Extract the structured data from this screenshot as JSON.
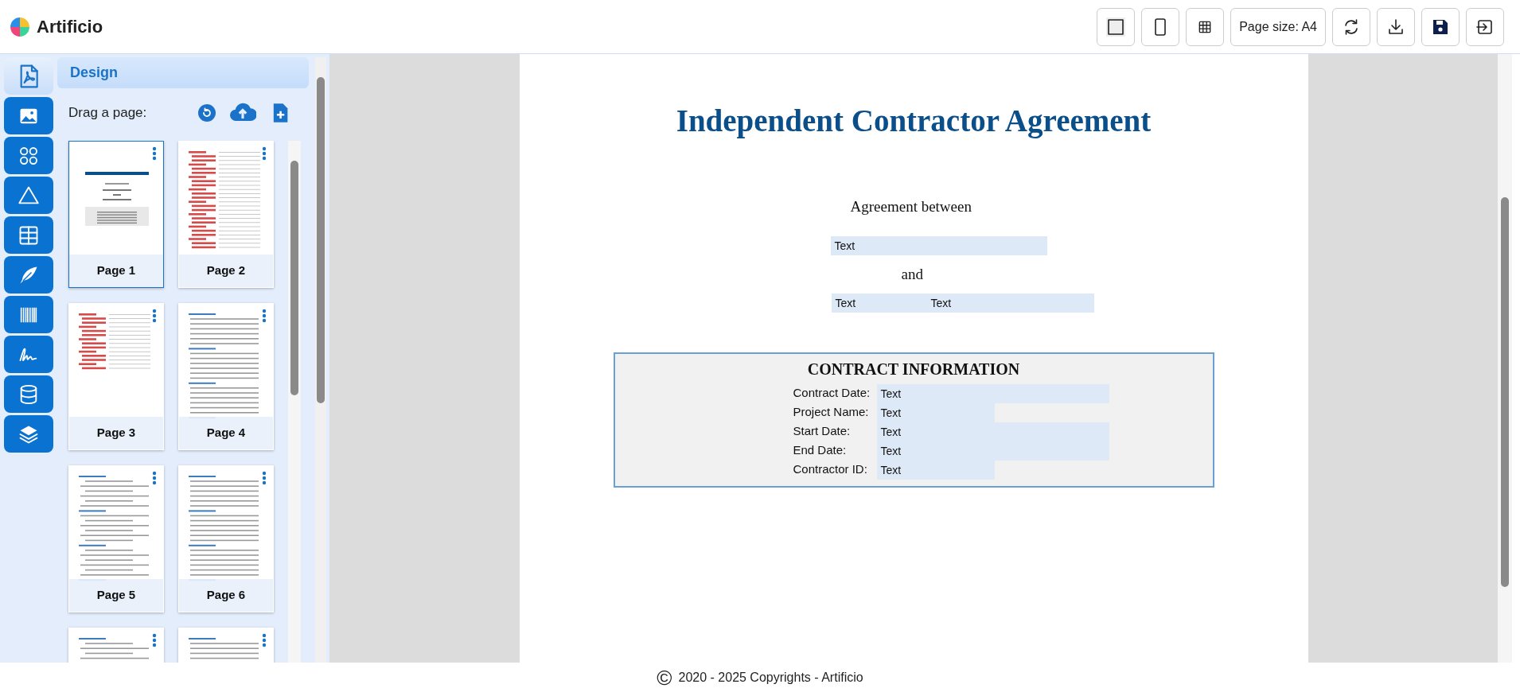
{
  "app": {
    "name": "Artificio"
  },
  "toolbar": [
    {
      "kind": "square",
      "selected": true
    },
    {
      "kind": "portrait",
      "selected": false
    },
    {
      "kind": "grid",
      "selected": false
    },
    {
      "kind": "label",
      "label": "Page size: A4"
    },
    {
      "kind": "refresh"
    },
    {
      "kind": "download"
    },
    {
      "kind": "save"
    },
    {
      "kind": "exit"
    }
  ],
  "tool_rail": [
    {
      "kind": "pdf",
      "selected": true
    },
    {
      "kind": "image",
      "selected": false
    },
    {
      "kind": "shapes",
      "selected": false
    },
    {
      "kind": "triangle",
      "selected": false
    },
    {
      "kind": "table",
      "selected": false
    },
    {
      "kind": "feather",
      "selected": false
    },
    {
      "kind": "barcode",
      "selected": false
    },
    {
      "kind": "signature",
      "selected": false
    },
    {
      "kind": "database",
      "selected": false
    },
    {
      "kind": "layers",
      "selected": false
    }
  ],
  "panel": {
    "title": "Design",
    "hint": "Drag a page:",
    "actions": [
      {
        "kind": "refresh"
      },
      {
        "kind": "upload"
      },
      {
        "kind": "add-page"
      }
    ],
    "pages": [
      {
        "label": "Page 1",
        "selected": true,
        "kind": "cover"
      },
      {
        "label": "Page 2",
        "selected": false,
        "kind": "contents"
      },
      {
        "label": "Page 3",
        "selected": false,
        "kind": "contents-end"
      },
      {
        "label": "Page 4",
        "selected": false,
        "kind": "text"
      },
      {
        "label": "Page 5",
        "selected": false,
        "kind": "list"
      },
      {
        "label": "Page 6",
        "selected": false,
        "kind": "text"
      },
      {
        "selected": false,
        "kind": "list"
      },
      {
        "selected": false,
        "kind": "text"
      }
    ]
  },
  "document": {
    "title": "Independent Contractor Agreement",
    "intro": "Agreement between",
    "party_1": [
      {
        "value": "Text",
        "kind": "wide"
      }
    ],
    "joiner": "and",
    "party_2": [
      {
        "value": "Text",
        "kind": "narrow"
      },
      {
        "value": "Text",
        "kind": "medium"
      }
    ],
    "contract_info": {
      "heading": "CONTRACT INFORMATION",
      "rows": [
        {
          "label": "Contract Date:",
          "value": "Text",
          "kind": "long"
        },
        {
          "label": "Project Name:",
          "value": "Text",
          "kind": "short"
        },
        {
          "label": "Start Date:",
          "value": "Text",
          "kind": "long"
        },
        {
          "label": "End Date:",
          "value": "Text",
          "kind": "long"
        },
        {
          "label": "Contractor ID:",
          "value": "Text",
          "kind": "short"
        }
      ]
    }
  },
  "footer": {
    "mark": "©",
    "text": "2020 - 2025 Copyrights - Artificio"
  }
}
